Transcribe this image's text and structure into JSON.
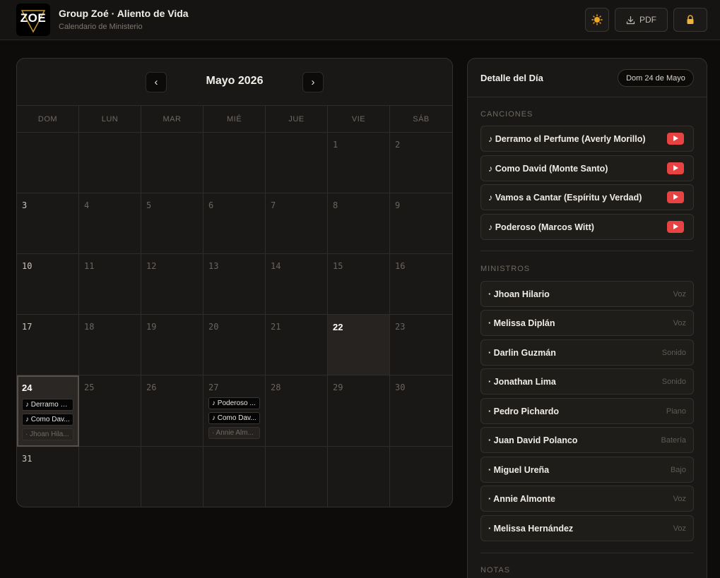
{
  "header": {
    "logo_text": "ZOE",
    "title": "Group Zoé · Aliento de Vida",
    "subtitle": "Calendario de Ministerio",
    "theme_icon": "sun-icon",
    "pdf_label": "PDF",
    "download_icon": "download-icon",
    "lock_icon": "lock-icon"
  },
  "calendar": {
    "month_title": "Mayo 2026",
    "prev": "‹",
    "next": "›",
    "weekdays": [
      "DOM",
      "LUN",
      "MAR",
      "MIÉ",
      "JUE",
      "VIE",
      "SÁB"
    ],
    "today": 22,
    "selected": 24,
    "days": [
      "",
      "",
      "",
      "",
      "",
      "1",
      "2",
      "3",
      "4",
      "5",
      "6",
      "7",
      "8",
      "9",
      "10",
      "11",
      "12",
      "13",
      "14",
      "15",
      "16",
      "17",
      "18",
      "19",
      "20",
      "21",
      "22",
      "23",
      "24",
      "25",
      "26",
      "27",
      "28",
      "29",
      "30",
      "31",
      "",
      "",
      "",
      "",
      "",
      ""
    ],
    "events": {
      "24": [
        "♪ Derramo e...",
        "♪ Como Dav...",
        "· Jhoan Hila..."
      ],
      "27": [
        "♪ Poderoso ...",
        "♪ Como Dav...",
        "· Annie Alm..."
      ]
    }
  },
  "panel": {
    "title": "Detalle del Día",
    "date_pill": "Dom 24 de Mayo",
    "songs_label": "CANCIONES",
    "songs": [
      "♪ Derramo el Perfume (Averly Morillo)",
      "♪ Como David (Monte Santo)",
      "♪ Vamos a Cantar (Espíritu y Verdad)",
      "♪ Poderoso (Marcos Witt)"
    ],
    "ministers_label": "MINISTROS",
    "ministers": [
      {
        "name": "· Jhoan Hilario",
        "role": "Voz"
      },
      {
        "name": "· Melissa Diplán",
        "role": "Voz"
      },
      {
        "name": "· Darlin Guzmán",
        "role": "Sonido"
      },
      {
        "name": "· Jonathan Lima",
        "role": "Sonido"
      },
      {
        "name": "· Pedro Pichardo",
        "role": "Piano"
      },
      {
        "name": "· Juan David Polanco",
        "role": "Batería"
      },
      {
        "name": "· Miguel Ureña",
        "role": "Bajo"
      },
      {
        "name": "· Annie Almonte",
        "role": "Voz"
      },
      {
        "name": "· Melissa Hernández",
        "role": "Voz"
      }
    ],
    "notes_label": "NOTAS"
  },
  "colors": {
    "background": "#0d0c0b",
    "card": "#1a1816",
    "youtube_red": "#e84343",
    "sun": "#f0a623"
  }
}
